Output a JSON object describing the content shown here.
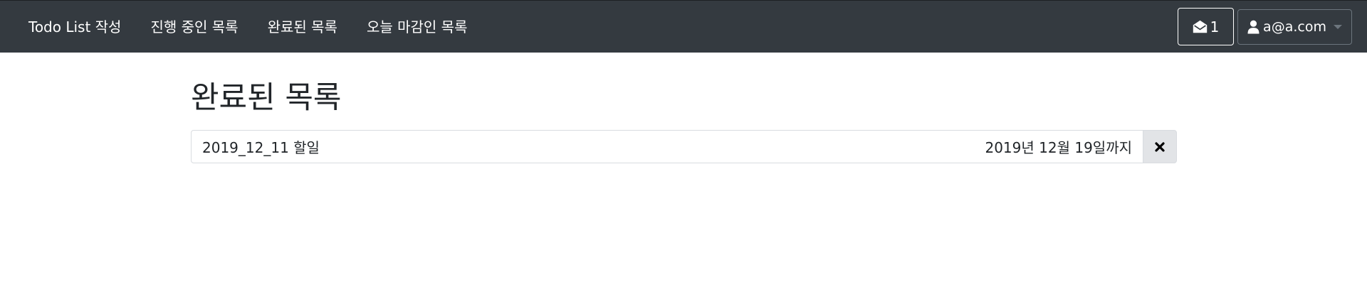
{
  "nav": {
    "items": [
      {
        "label": "Todo List 작성"
      },
      {
        "label": "진행 중인 목록"
      },
      {
        "label": "완료된 목록"
      },
      {
        "label": "오늘 마감인 목록"
      }
    ],
    "messages": {
      "count": "1",
      "icon": "envelope-open-icon"
    },
    "user": {
      "email": "a@a.com",
      "icon": "user-icon"
    }
  },
  "main": {
    "title": "완료된 목록",
    "todos": [
      {
        "title": "2019_12_11 할일",
        "deadline": "2019년 12월 19일까지",
        "delete_icon": "close-icon"
      }
    ]
  },
  "colors": {
    "navbar_bg": "#343a40",
    "delete_button_bg": "#e2e4e7"
  }
}
